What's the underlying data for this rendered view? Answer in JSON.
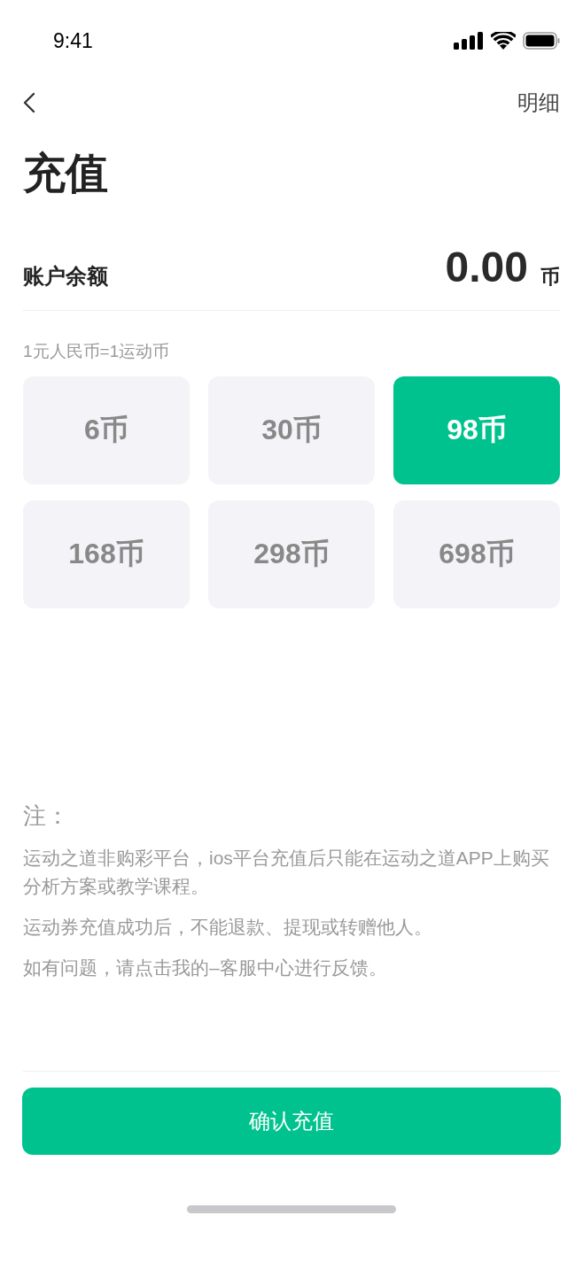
{
  "status_bar": {
    "time": "9:41"
  },
  "nav": {
    "action": "明细"
  },
  "title": "充值",
  "balance": {
    "label": "账户余额",
    "amount": "0.00",
    "unit": "币"
  },
  "rate": "1元人民币=1运动币",
  "options": [
    {
      "label": "6币",
      "selected": false
    },
    {
      "label": "30币",
      "selected": false
    },
    {
      "label": "98币",
      "selected": true
    },
    {
      "label": "168币",
      "selected": false
    },
    {
      "label": "298币",
      "selected": false
    },
    {
      "label": "698币",
      "selected": false
    }
  ],
  "notes": {
    "heading": "注：",
    "items": [
      "运动之道非购彩平台，ios平台充值后只能在运动之道APP上购买分析方案或教学课程。",
      "运动券充值成功后，不能退款、提现或转赠他人。",
      "如有问题，请点击我的–客服中心进行反馈。"
    ]
  },
  "confirm_button": "确认充值"
}
